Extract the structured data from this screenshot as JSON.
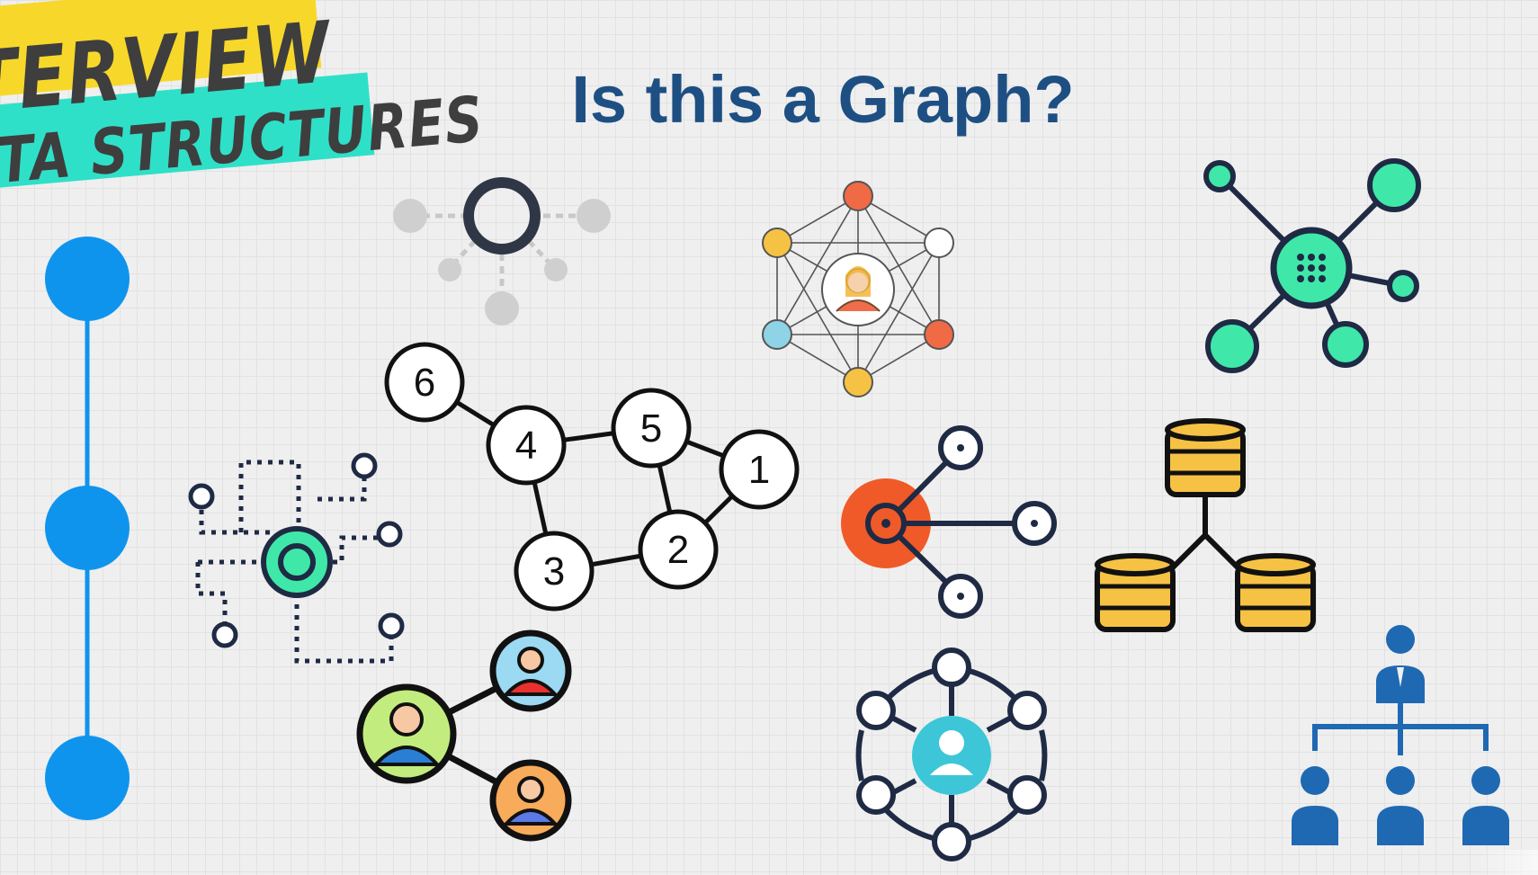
{
  "banner": {
    "line1": "TERVIEW",
    "line2": "ATA STRUCTURES"
  },
  "title": "Is this a Graph?",
  "numbered_graph": {
    "nodes": [
      "6",
      "4",
      "5",
      "1",
      "3",
      "2"
    ]
  },
  "colors": {
    "title": "#1e4f83",
    "timeline_blue": "#0f94ee",
    "teal_green": "#3fe8a8",
    "dark_navy": "#1f2a44",
    "orange_red": "#f05a28",
    "gold": "#f6c244",
    "org_blue": "#1f69b3",
    "hex_teal": "#3cc6d8"
  },
  "icons": [
    "timeline-icon",
    "hub-network-icon",
    "person-network-icon",
    "molecule-network-icon",
    "circuit-network-icon",
    "numbered-graph-icon",
    "share-icon",
    "database-tree-icon",
    "people-connections-icon",
    "user-hex-network-icon",
    "org-chart-icon"
  ]
}
